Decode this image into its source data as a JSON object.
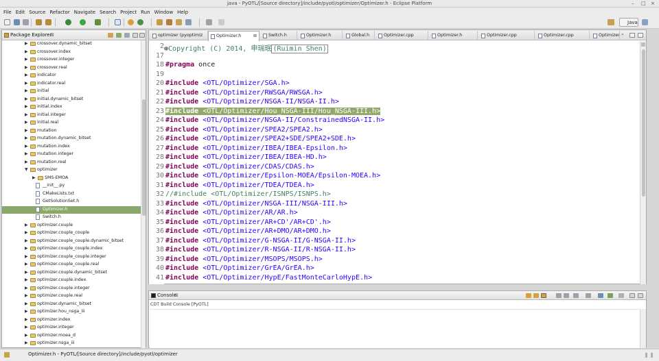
{
  "window": {
    "title": "java - PyOTL/[Source directory]/include/pyotl/optimizer/Optimizer.h - Eclipse Platform",
    "min": "–",
    "max": "□",
    "close": "×"
  },
  "menu": [
    "File",
    "Edit",
    "Source",
    "Refactor",
    "Navigate",
    "Search",
    "Project",
    "Run",
    "Window",
    "Help"
  ],
  "perspective": "Java",
  "package_explorer": {
    "title": "Package Explorer",
    "close": "⊠",
    "items": [
      {
        "label": "crossover.dynamic_bitset",
        "type": "folder",
        "depth": 1,
        "arrow": "▶"
      },
      {
        "label": "crossover.index",
        "type": "folder",
        "depth": 1,
        "arrow": "▶"
      },
      {
        "label": "crossover.integer",
        "type": "folder",
        "depth": 1,
        "arrow": "▶"
      },
      {
        "label": "crossover.real",
        "type": "folder",
        "depth": 1,
        "arrow": "▶"
      },
      {
        "label": "indicator",
        "type": "folder",
        "depth": 1,
        "arrow": "▶"
      },
      {
        "label": "indicator.real",
        "type": "folder",
        "depth": 1,
        "arrow": "▶"
      },
      {
        "label": "initial",
        "type": "folder",
        "depth": 1,
        "arrow": "▶"
      },
      {
        "label": "initial.dynamic_bitset",
        "type": "folder",
        "depth": 1,
        "arrow": "▶"
      },
      {
        "label": "initial.index",
        "type": "folder",
        "depth": 1,
        "arrow": "▶"
      },
      {
        "label": "initial.integer",
        "type": "folder",
        "depth": 1,
        "arrow": "▶"
      },
      {
        "label": "initial.real",
        "type": "folder",
        "depth": 1,
        "arrow": "▶"
      },
      {
        "label": "mutation",
        "type": "folder",
        "depth": 1,
        "arrow": "▶"
      },
      {
        "label": "mutation.dynamic_bitset",
        "type": "folder",
        "depth": 1,
        "arrow": "▶"
      },
      {
        "label": "mutation.index",
        "type": "folder",
        "depth": 1,
        "arrow": "▶"
      },
      {
        "label": "mutation.integer",
        "type": "folder",
        "depth": 1,
        "arrow": "▶"
      },
      {
        "label": "mutation.real",
        "type": "folder",
        "depth": 1,
        "arrow": "▶"
      },
      {
        "label": "optimizer",
        "type": "folder",
        "depth": 1,
        "arrow": "▼"
      },
      {
        "label": "SMS-EMOA",
        "type": "folder",
        "depth": 2,
        "arrow": "▶"
      },
      {
        "label": "__init__.py",
        "type": "file",
        "depth": 2,
        "arrow": ""
      },
      {
        "label": "CMakeLists.txt",
        "type": "file",
        "depth": 2,
        "arrow": ""
      },
      {
        "label": "GetSolutionSet.h",
        "type": "file",
        "depth": 2,
        "arrow": ""
      },
      {
        "label": "Optimizer.h",
        "type": "file",
        "depth": 2,
        "arrow": "",
        "selected": true
      },
      {
        "label": "Switch.h",
        "type": "file",
        "depth": 2,
        "arrow": ""
      },
      {
        "label": "optimizer.couple",
        "type": "folder",
        "depth": 1,
        "arrow": "▶"
      },
      {
        "label": "optimizer.couple_couple",
        "type": "folder",
        "depth": 1,
        "arrow": "▶"
      },
      {
        "label": "optimizer.couple_couple.dynamic_bitset",
        "type": "folder",
        "depth": 1,
        "arrow": "▶"
      },
      {
        "label": "optimizer.couple_couple.index",
        "type": "folder",
        "depth": 1,
        "arrow": "▶"
      },
      {
        "label": "optimizer.couple_couple.integer",
        "type": "folder",
        "depth": 1,
        "arrow": "▶"
      },
      {
        "label": "optimizer.couple_couple.real",
        "type": "folder",
        "depth": 1,
        "arrow": "▶"
      },
      {
        "label": "optimizer.couple.dynamic_bitset",
        "type": "folder",
        "depth": 1,
        "arrow": "▶"
      },
      {
        "label": "optimizer.couple.index",
        "type": "folder",
        "depth": 1,
        "arrow": "▶"
      },
      {
        "label": "optimizer.couple.integer",
        "type": "folder",
        "depth": 1,
        "arrow": "▶"
      },
      {
        "label": "optimizer.couple.real",
        "type": "folder",
        "depth": 1,
        "arrow": "▶"
      },
      {
        "label": "optimizer.dynamic_bitset",
        "type": "folder",
        "depth": 1,
        "arrow": "▶"
      },
      {
        "label": "optimizer.hou_nsga_iii",
        "type": "folder",
        "depth": 1,
        "arrow": "▶"
      },
      {
        "label": "optimizer.index",
        "type": "folder",
        "depth": 1,
        "arrow": "▶"
      },
      {
        "label": "optimizer.integer",
        "type": "folder",
        "depth": 1,
        "arrow": "▶"
      },
      {
        "label": "optimizer.moea_d",
        "type": "folder",
        "depth": 1,
        "arrow": "▶"
      },
      {
        "label": "optimizer.nsga_iii",
        "type": "folder",
        "depth": 1,
        "arrow": "▶"
      }
    ]
  },
  "editor": {
    "tabs": [
      {
        "label": "optimizer (pyoptimiz"
      },
      {
        "label": "Optimizer.h",
        "active": true,
        "close": "⊠"
      },
      {
        "label": "Switch.h"
      },
      {
        "label": "Optimizer.h"
      },
      {
        "label": "Global.h"
      },
      {
        "label": "Optimizer.cpp"
      },
      {
        "label": "Optimizer.h"
      },
      {
        "label": "Optimizer.cpp"
      },
      {
        "label": "Optimizer.cpp"
      },
      {
        "label": "Optimizer.h"
      }
    ],
    "overflow": "»",
    "lines": [
      {
        "n": "2",
        "marker": "⊕",
        "kind": "comment",
        "text": "Copyright (C) 2014, 申瑞珉",
        "boxed": "(Ruimin Shen)"
      },
      {
        "n": "17",
        "kind": "blank",
        "text": ""
      },
      {
        "n": "18",
        "kind": "pragma",
        "kw": "#pragma",
        "rest": " once"
      },
      {
        "n": "19",
        "kind": "blank",
        "text": ""
      },
      {
        "n": "20",
        "kind": "include",
        "kw": "#include",
        "path": "<OTL/Optimizer/SGA.h>"
      },
      {
        "n": "21",
        "kind": "include",
        "kw": "#include",
        "path": "<OTL/Optimizer/RWSGA/RWSGA.h>"
      },
      {
        "n": "22",
        "kind": "include",
        "kw": "#include",
        "path": "<OTL/Optimizer/NSGA-II/NSGA-II.h>"
      },
      {
        "n": "23",
        "kind": "include",
        "kw": "#include",
        "path": "<OTL/Optimizer/Hou_NSGA-III/Hou_NSGA-III.h>",
        "highlight": true
      },
      {
        "n": "24",
        "kind": "include",
        "kw": "#include",
        "path": "<OTL/Optimizer/NSGA-II/ConstrainedNSGA-II.h>"
      },
      {
        "n": "25",
        "kind": "include",
        "kw": "#include",
        "path": "<OTL/Optimizer/SPEA2/SPEA2.h>"
      },
      {
        "n": "26",
        "kind": "include",
        "kw": "#include",
        "path": "<OTL/Optimizer/SPEA2+SDE/SPEA2+SDE.h>"
      },
      {
        "n": "27",
        "kind": "include",
        "kw": "#include",
        "path": "<OTL/Optimizer/IBEA/IBEA-Epsilon.h>"
      },
      {
        "n": "28",
        "kind": "include",
        "kw": "#include",
        "path": "<OTL/Optimizer/IBEA/IBEA-HD.h>"
      },
      {
        "n": "29",
        "kind": "include",
        "kw": "#include",
        "path": "<OTL/Optimizer/CDAS/CDAS.h>"
      },
      {
        "n": "30",
        "kind": "include",
        "kw": "#include",
        "path": "<OTL/Optimizer/Epsilon-MOEA/Epsilon-MOEA.h>"
      },
      {
        "n": "31",
        "kind": "include",
        "kw": "#include",
        "path": "<OTL/Optimizer/TDEA/TDEA.h>"
      },
      {
        "n": "32",
        "kind": "commentline",
        "text": "//#include <OTL/Optimizer/ISNPS/ISNPS.h>"
      },
      {
        "n": "33",
        "kind": "include",
        "kw": "#include",
        "path": "<OTL/Optimizer/NSGA-III/NSGA-III.h>"
      },
      {
        "n": "34",
        "kind": "include",
        "kw": "#include",
        "path": "<OTL/Optimizer/AR/AR.h>"
      },
      {
        "n": "35",
        "kind": "include",
        "kw": "#include",
        "path": "<OTL/Optimizer/AR+CD'/AR+CD'.h>"
      },
      {
        "n": "36",
        "kind": "include",
        "kw": "#include",
        "path": "<OTL/Optimizer/AR+DMO/AR+DMO.h>"
      },
      {
        "n": "37",
        "kind": "include",
        "kw": "#include",
        "path": "<OTL/Optimizer/G-NSGA-II/G-NSGA-II.h>"
      },
      {
        "n": "38",
        "kind": "include",
        "kw": "#include",
        "path": "<OTL/Optimizer/R-NSGA-II/R-NSGA-II.h>"
      },
      {
        "n": "39",
        "kind": "include",
        "kw": "#include",
        "path": "<OTL/Optimizer/MSOPS/MSOPS.h>"
      },
      {
        "n": "40",
        "kind": "include",
        "kw": "#include",
        "path": "<OTL/Optimizer/GrEA/GrEA.h>"
      },
      {
        "n": "41",
        "kind": "include",
        "kw": "#include",
        "path": "<OTL/Optimizer/HypE/FastMonteCarloHypE.h>"
      }
    ]
  },
  "console": {
    "title": "Console",
    "close": "⊠",
    "subtitle": "CDT Build Console [PyOTL]"
  },
  "status": {
    "text": "Optimizer.h - PyOTL/[Source directory]/include/pyotl/optimizer"
  },
  "colors": {
    "keyword": "#7f0055",
    "string": "#2a00ff",
    "comment": "#3f7f5f",
    "selection": "#8aa867"
  }
}
